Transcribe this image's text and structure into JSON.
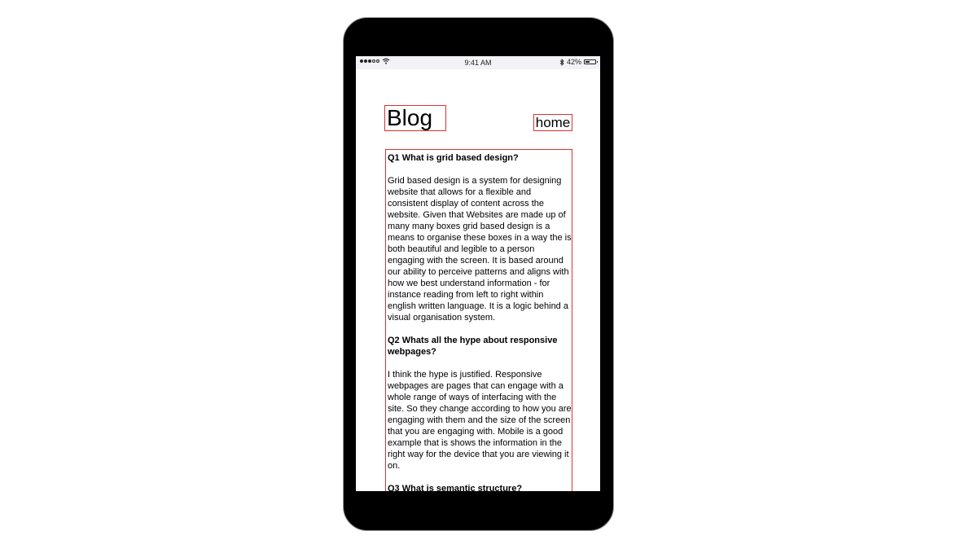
{
  "status_bar": {
    "time": "9:41 AM",
    "battery": "42%",
    "battery_level": 0.42
  },
  "header": {
    "title": "Blog",
    "home_label": "home"
  },
  "articles": [
    {
      "question": "Q1 What is grid based design?",
      "answer": "Grid based design is a system for designing website that allows for a flexible and consistent display of content across the website. Given that Websites are made up of many many boxes grid based design is a means to organise these boxes in a way the is both beautiful and legible to a person engaging with the screen. It is based around our ability to perceive patterns and aligns with how we best understand information - for instance reading from left to right within english written language. It is a logic behind a visual organisation system."
    },
    {
      "question": "Q2 Whats all the hype about responsive webpages?",
      "answer": "I think the hype is justified. Responsive webpages are pages that can engage with a whole range of ways of interfacing with the site. So they change according to how you are engaging with them and the size of the screen that you are engaging with. Mobile is a good example that is shows the information in the right way for the device that you are viewing it on."
    },
    {
      "question": "Q3 What is semantic structure?",
      "answer": ""
    }
  ]
}
